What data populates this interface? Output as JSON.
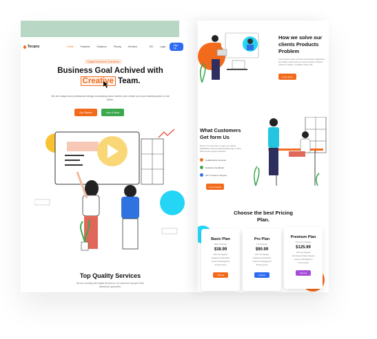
{
  "nav": {
    "logo": "Tecqnu",
    "items": [
      "Home",
      "Features",
      "Solutions",
      "Pricing",
      "Services"
    ],
    "lang": "EN",
    "login": "Login",
    "signup": "Sign Up"
  },
  "hero": {
    "badge": "Digital Business Solutions",
    "title_line1": "Business Goal Achived with",
    "title_highlight": "Creative",
    "title_end": " Team.",
    "subtitle": "We are unique and professional design consultancy since twelve year create sure your business plan in one place.",
    "btn_primary": "Get Started",
    "btn_secondary": "How It Work"
  },
  "services": {
    "title": "Top Quality Services",
    "subtitle": "We are providing best digital services to our customers and give them satisfaction guarantee."
  },
  "solve": {
    "title": "How we solve our clients Products Problem",
    "text": "Lorem ipsum dolor sit amet consectetur adipiscing elit. Nulla ornare tortor at metus semper, facilisis nulla at a sapien. Curabitur vitae velit.",
    "button": "Know More"
  },
  "customers": {
    "title": "What Customers Get form Us",
    "text": "We try our best and to make our clients satisfaction and everything delivering on time with secure project solutions.",
    "features": [
      "Collaborative Ventures",
      "Real-time Feedback",
      "24/7 Customer Support"
    ],
    "feature_colors": [
      "#f26b1d",
      "#3ca84e",
      "#2d6cf0"
    ],
    "button": "Know Details"
  },
  "pricing": {
    "title": "Choose the best Pricing Plan.",
    "plans": [
      {
        "name": "Basic Plan",
        "sub": "Basic Package",
        "price": "$38.99",
        "features": [
          "24/7 Live Support",
          "Analytics & Automation",
          "Customer Management",
          "30 Day access"
        ],
        "button": "Choose",
        "color": "#f26b1d"
      },
      {
        "name": "Pro Plan",
        "sub": "Pro Package",
        "price": "$90.99",
        "features": [
          "24/7 Live Support",
          "Analytics & Automation",
          "Customer Management",
          "60 Day access"
        ],
        "button": "Choose",
        "color": "#2d6cf0"
      },
      {
        "name": "Premium Plan",
        "sub": "Premium Package",
        "price": "$125.99",
        "features": [
          "24/7 Live Support",
          "Full Access Product Support",
          "Customer Management",
          "1 Year Access"
        ],
        "button": "Choose",
        "color": "#a64bd9"
      }
    ]
  }
}
